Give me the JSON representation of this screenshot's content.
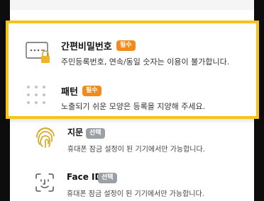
{
  "auth_options": [
    {
      "title": "간편비밀번호",
      "badge": "필수",
      "description": "주민등록번호, 연속/동일 숫자는 이용이 불가합니다.",
      "icon": "password-card-lock-icon"
    },
    {
      "title": "패턴",
      "badge": "필수",
      "description": "노출되기 쉬운 모양은 등록을 지양해 주세요.",
      "icon": "pattern-dots-icon"
    },
    {
      "title": "지문",
      "badge": "선택",
      "description": "휴대폰 잠금 설정이 된 기기에서만 가능합니다.",
      "icon": "fingerprint-icon"
    },
    {
      "title": "Face ID",
      "badge": "선택",
      "description": "휴대폰 잠금 설정이 된 기기에서만 가능합니다.",
      "icon": "face-id-icon"
    }
  ],
  "colors": {
    "highlight_border": "#f6c31a",
    "badge_required": "#f28a1c",
    "badge_optional": "#9aa0a6",
    "fingerprint": "#d9a21b"
  }
}
